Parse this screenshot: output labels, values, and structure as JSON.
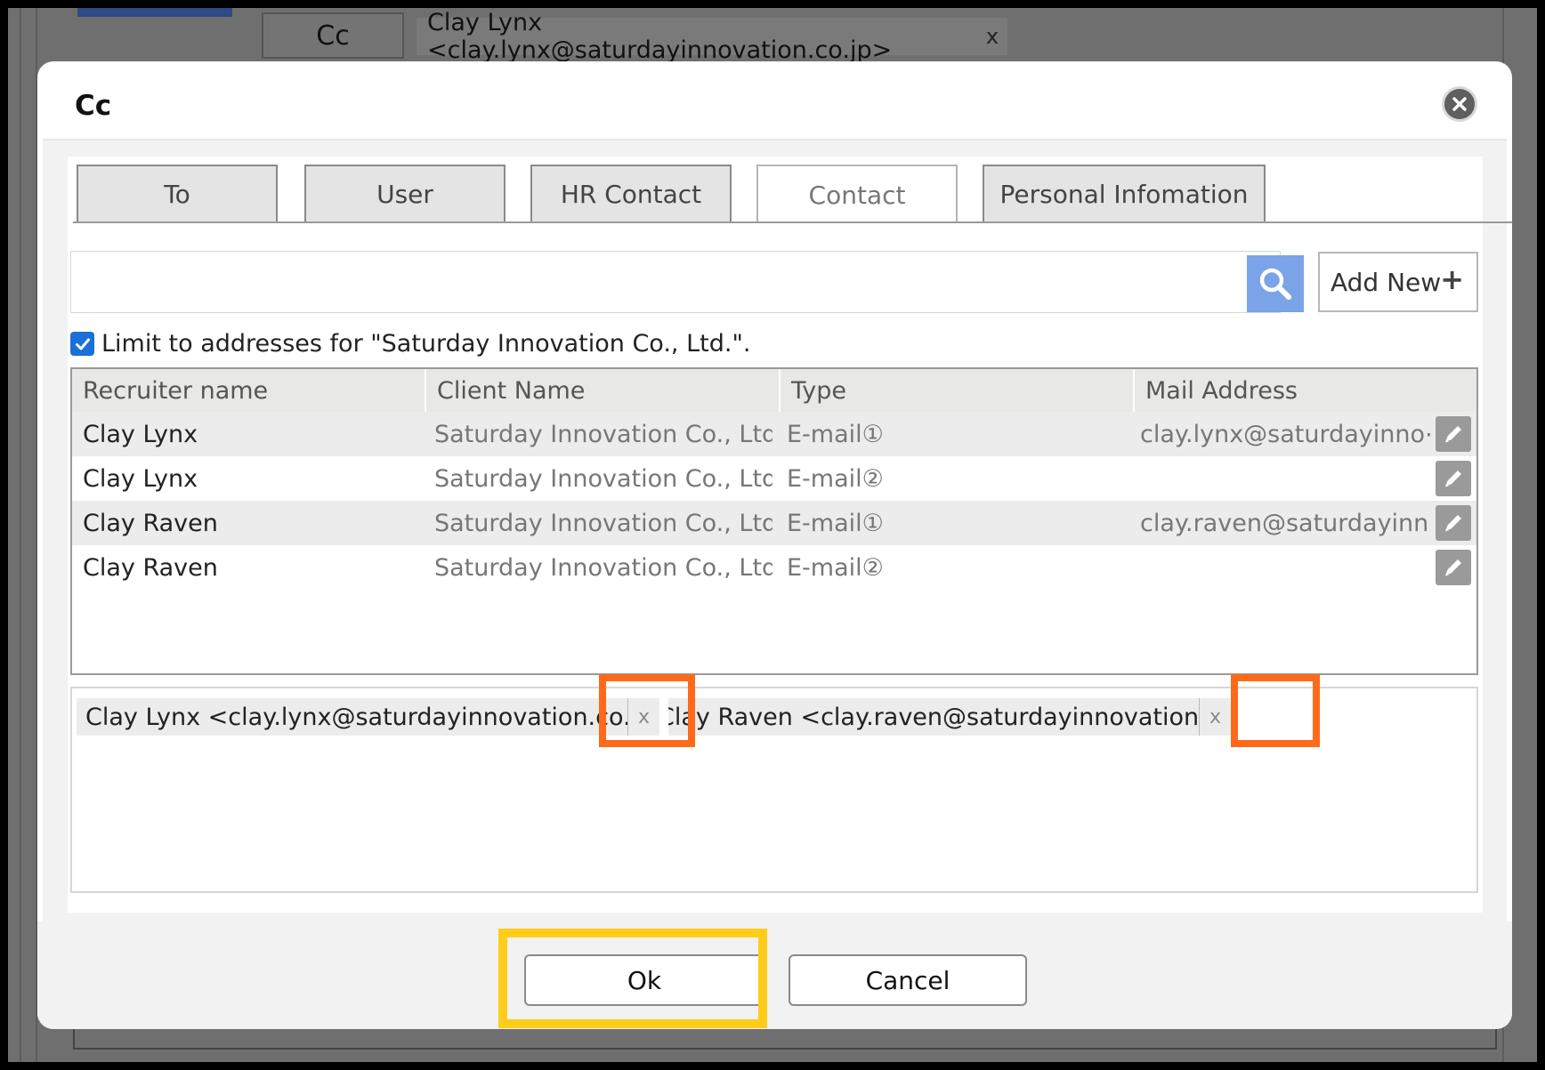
{
  "background": {
    "cc_label": "Cc",
    "chip_text": "Clay Lynx <clay.lynx@saturdayinnovation.co.jp>",
    "chip_remove": "x"
  },
  "dialog": {
    "title": "Cc",
    "tabs": [
      {
        "label": "To",
        "active": false
      },
      {
        "label": "User",
        "active": false
      },
      {
        "label": "HR Contact",
        "active": false
      },
      {
        "label": "Contact",
        "active": true
      },
      {
        "label": "Personal Infomation",
        "active": false
      }
    ],
    "search": {
      "value": "",
      "placeholder": ""
    },
    "add_new_label": "Add New",
    "add_new_icon": "+",
    "limit_checkbox": {
      "checked": true,
      "label": "Limit to addresses for \"Saturday Innovation Co., Ltd.\"."
    },
    "table": {
      "headers": [
        "Recruiter name",
        "Client Name",
        "Type",
        "Mail Address"
      ],
      "rows": [
        {
          "recruiter": "Clay Lynx",
          "client": "Saturday Innovation Co., Ltd.",
          "type": "E-mail①",
          "mail": "clay.lynx@saturdayinno⋯"
        },
        {
          "recruiter": "Clay Lynx",
          "client": "Saturday Innovation Co., Ltd.",
          "type": "E-mail②",
          "mail": ""
        },
        {
          "recruiter": "Clay Raven",
          "client": "Saturday Innovation Co., Ltd.",
          "type": "E-mail①",
          "mail": "clay.raven@saturdayinn⋯"
        },
        {
          "recruiter": "Clay Raven",
          "client": "Saturday Innovation Co., Ltd.",
          "type": "E-mail②",
          "mail": ""
        }
      ]
    },
    "selected": [
      {
        "text": "Clay Lynx <clay.lynx@saturdayinnovation.co.jp>",
        "remove": "x"
      },
      {
        "text": "Clay Raven <clay.raven@saturdayinnovation.co.jp>",
        "remove": "x"
      }
    ],
    "ok_label": "Ok",
    "cancel_label": "Cancel"
  },
  "colors": {
    "highlight_remove": "#ff6a1a",
    "highlight_ok": "#ffcc1a",
    "search_button": "#7aa3e8",
    "checkbox": "#1c6fd6"
  }
}
